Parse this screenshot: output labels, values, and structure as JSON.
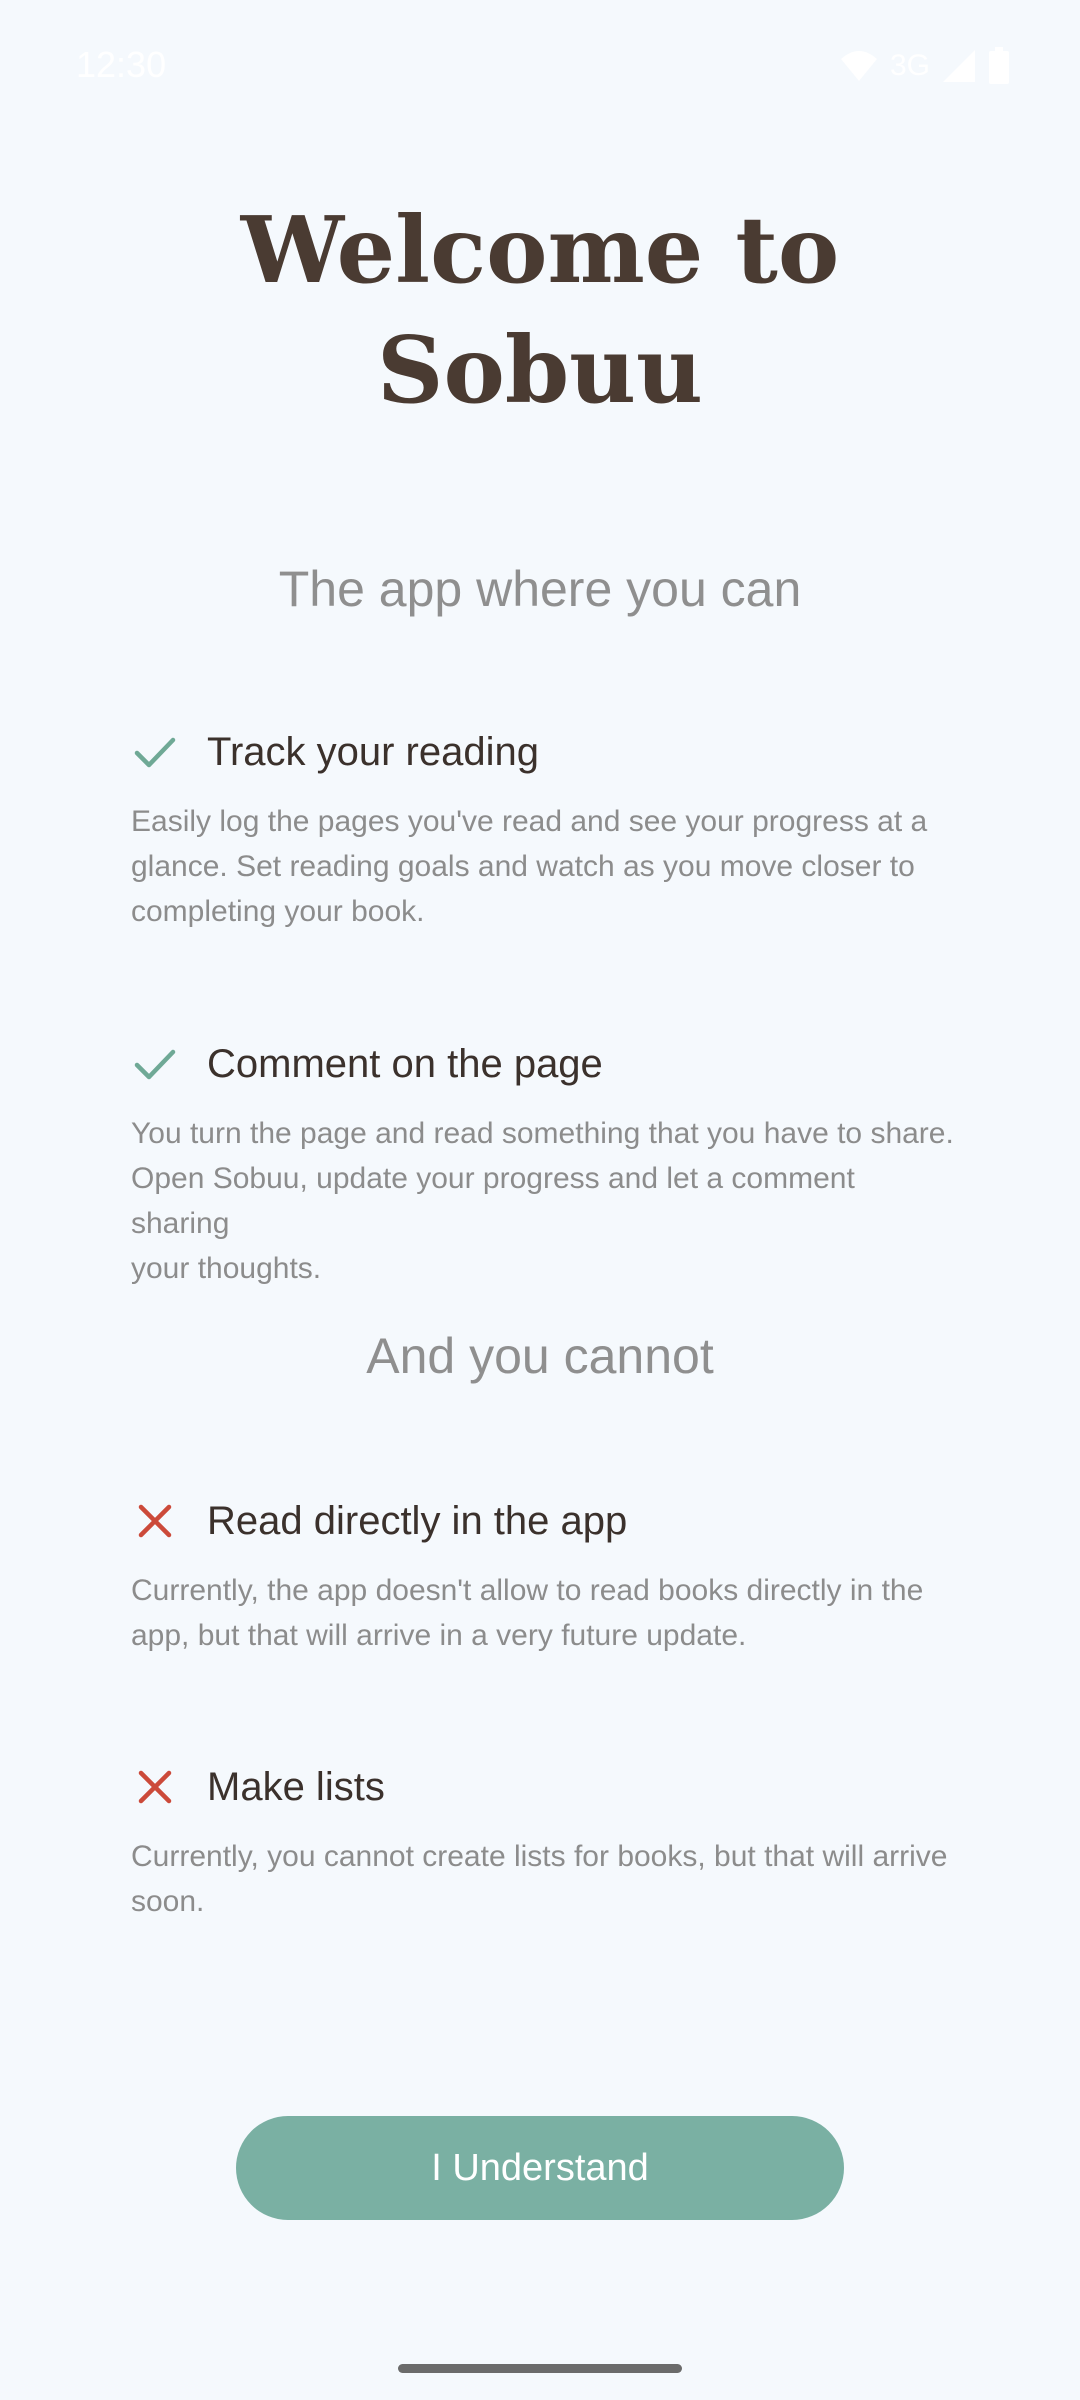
{
  "status_bar": {
    "time": "12:30",
    "network": "3G",
    "icons": [
      "wifi-icon",
      "signal-icon",
      "battery-icon"
    ]
  },
  "title": {
    "line1": "Welcome to",
    "line2": "Sobuu"
  },
  "can_section": {
    "heading": "The app where you can",
    "items": [
      {
        "icon": "check-icon",
        "title": "Track your reading",
        "desc_lines": [
          "Easily log the pages you've read and see your progress at a",
          "glance. Set reading goals and watch as you move closer to",
          "completing your book."
        ]
      },
      {
        "icon": "check-icon",
        "title": "Comment on the page",
        "desc_lines": [
          "You turn the page and read something that you have to share.",
          "Open Sobuu, update your progress and let a comment sharing",
          "your thoughts."
        ]
      }
    ]
  },
  "cannot_section": {
    "heading": "And you cannot",
    "items": [
      {
        "icon": "cross-icon",
        "title": "Read directly in the app",
        "desc_lines": [
          "Currently, the app doesn't allow to read books directly in the",
          "app, but that will arrive in a very future update."
        ]
      },
      {
        "icon": "cross-icon",
        "title": "Make lists",
        "desc_lines": [
          "Currently, you cannot create lists for books, but that will arrive",
          "soon."
        ]
      }
    ]
  },
  "button": {
    "label": "I Understand"
  },
  "colors": {
    "background": "#f5f9fd",
    "title": "#4a3b32",
    "accent": "#7ab0a3",
    "check": "#6fa996",
    "cross": "#cc4a3a"
  }
}
